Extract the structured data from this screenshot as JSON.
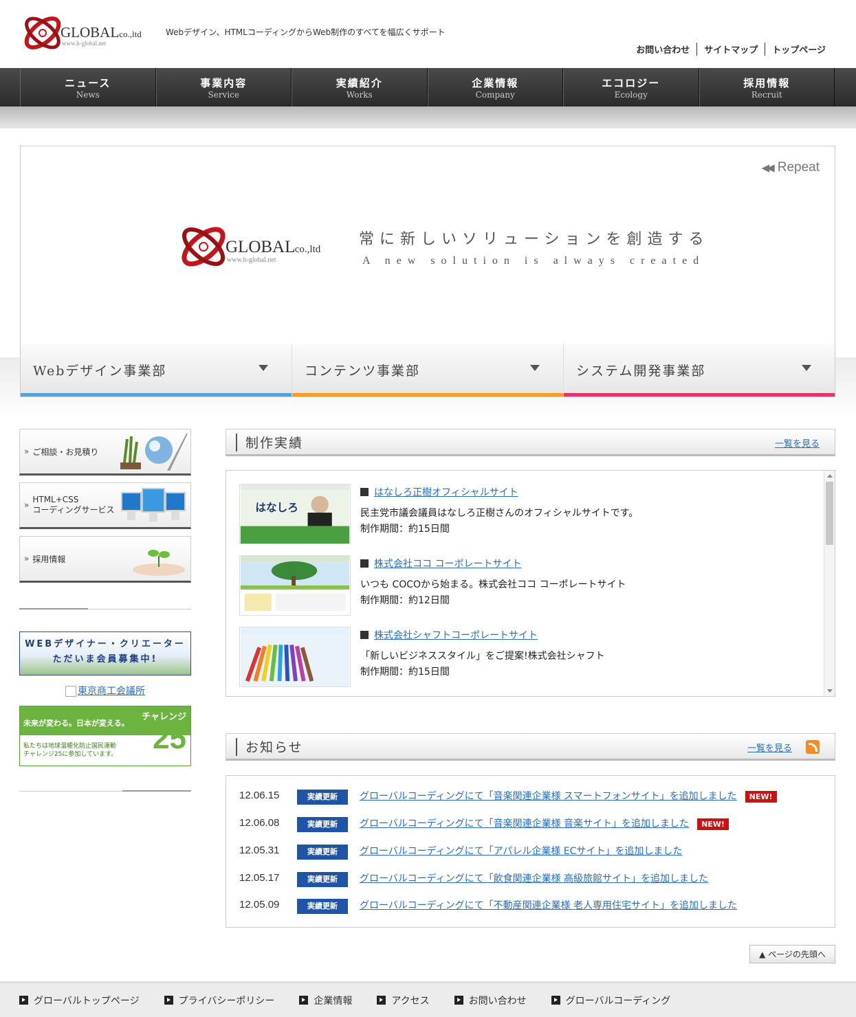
{
  "header": {
    "logo_text": "GLOBAL.co.,ltd",
    "logo_url_text": "www.h-global.net",
    "tagline": "Webデザイン、HTMLコーディングからWeb制作のすべてを幅広くサポート",
    "utility_links": [
      "お問い合わせ",
      "サイトマップ",
      "トップページ"
    ]
  },
  "nav": [
    {
      "jp": "ニュース",
      "en": "News"
    },
    {
      "jp": "事業内容",
      "en": "Service"
    },
    {
      "jp": "実績紹介",
      "en": "Works"
    },
    {
      "jp": "企業情報",
      "en": "Company"
    },
    {
      "jp": "エコロジー",
      "en": "Ecology"
    },
    {
      "jp": "採用情報",
      "en": "Recruit"
    }
  ],
  "hero": {
    "repeat_label": "Repeat",
    "slogan_jp": "常に新しいソリューションを創造する",
    "slogan_en": "A new solution is always created",
    "divisions": [
      {
        "label": "Webデザイン事業部",
        "color": "#5aa0d8"
      },
      {
        "label": "コンテンツ事業部",
        "color": "#f0a020"
      },
      {
        "label": "システム開発事業部",
        "color": "#e8336a"
      }
    ]
  },
  "sidebar": {
    "buttons": [
      {
        "label": "ご相談・お見積り",
        "icon": "plant-globe-laptop-icon"
      },
      {
        "label": "HTML+CSS\nコーディングサービス",
        "icon": "monitors-icon"
      },
      {
        "label": "採用情報",
        "icon": "sprout-hands-icon"
      }
    ],
    "banner_web_line1": "WEBデザイナー・クリエーター",
    "banner_web_line2": "ただいま会員募集中!",
    "tokyo_link": "東京商工会議所",
    "challenge_top": "未来が変わる。日本が変える。",
    "challenge_title": "チャレンジ",
    "challenge_num": "25",
    "challenge_bottom_1": "私たちは地球温暖化防止国民運動",
    "challenge_bottom_2": "チャレンジ25に参加しています。"
  },
  "works": {
    "heading": "制作実績",
    "more": "一覧を見る",
    "items": [
      {
        "title": "はなしろ正樹オフィシャルサイト",
        "desc": "民主党市議会議員はなしろ正樹さんのオフィシャルサイトです。",
        "period": "制作期間：約15日間"
      },
      {
        "title": "株式会社ココ コーポレートサイト",
        "desc": "いつも COCOから始まる。株式会社ココ コーポレートサイト",
        "period": "制作期間：約12日間"
      },
      {
        "title": "株式会社シャフトコーポレートサイト",
        "desc": "「新しいビジネススタイル」をご提案!株式会社シャフト",
        "period": "制作期間：約15日間"
      }
    ]
  },
  "news": {
    "heading": "お知らせ",
    "more": "一覧を見る",
    "badge": "実績更新",
    "new_label": "NEW!",
    "items": [
      {
        "date": "12.06.15",
        "text": "グローバルコーディングにて「音楽関連企業様 スマートフォンサイト」を追加しました",
        "is_new": true
      },
      {
        "date": "12.06.08",
        "text": "グローバルコーディングにて「音楽関連企業様 音楽サイト」を追加しました",
        "is_new": true
      },
      {
        "date": "12.05.31",
        "text": "グローバルコーディングにて「アパレル企業様 ECサイト」を追加しました",
        "is_new": false
      },
      {
        "date": "12.05.17",
        "text": "グローバルコーディングにて「飲食関連企業様 高級旅館サイト」を追加しました",
        "is_new": false
      },
      {
        "date": "12.05.09",
        "text": "グローバルコーディングにて「不動産関連企業様 老人専用住宅サイト」を追加しました",
        "is_new": false
      }
    ]
  },
  "pagetop": "▲ ページの先頭へ",
  "footer": [
    "グローバルトップページ",
    "プライバシーポリシー",
    "企業情報",
    "アクセス",
    "お問い合わせ",
    "グローバルコーディング"
  ]
}
